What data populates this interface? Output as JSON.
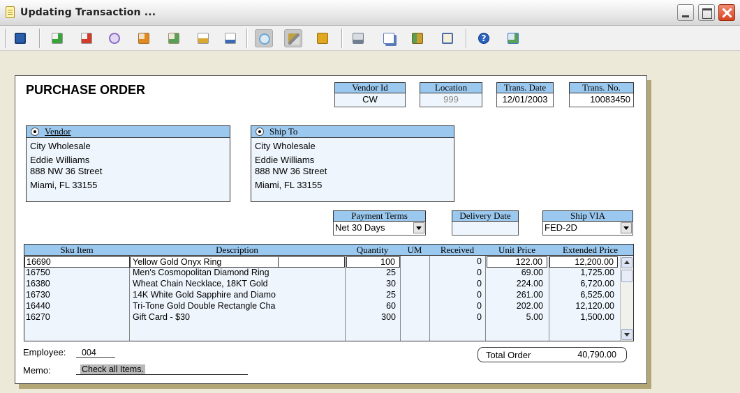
{
  "window": {
    "title": "Updating Transaction ..."
  },
  "toolbar": {
    "buttons": [
      {
        "name": "save-icon",
        "color": "#2a5ea8"
      },
      {
        "name": "add-new-icon",
        "color": "#3aa33a"
      },
      {
        "name": "delete-icon",
        "color": "#d23a2a"
      },
      {
        "name": "find-icon",
        "color": "#8a6bc2"
      },
      {
        "name": "approve-icon",
        "color": "#e08a20"
      },
      {
        "name": "add-item-icon",
        "color": "#58a058"
      },
      {
        "name": "import-icon",
        "color": "#d8a830"
      },
      {
        "name": "report-icon",
        "color": "#3a6ab8"
      },
      {
        "name": "refresh-icon",
        "color": "#6aa8d8"
      },
      {
        "name": "wand-icon",
        "color": "#c0a040"
      },
      {
        "name": "package-icon",
        "color": "#e0a820"
      },
      {
        "name": "print-icon",
        "color": "#708090"
      },
      {
        "name": "copy-icon",
        "color": "#5a7ab8"
      },
      {
        "name": "gift-icon",
        "color": "#c8a030"
      },
      {
        "name": "clipboard-icon",
        "color": "#4a6aa8"
      },
      {
        "name": "help-icon",
        "color": "#2a62c0"
      },
      {
        "name": "exit-icon",
        "color": "#3a7ac0"
      }
    ]
  },
  "document": {
    "title": "PURCHASE ORDER",
    "vendor_id": {
      "label": "Vendor Id",
      "value": "CW"
    },
    "location": {
      "label": "Location",
      "value": "999"
    },
    "trans_date": {
      "label": "Trans. Date",
      "value": "12/01/2003"
    },
    "trans_no": {
      "label": "Trans. No.",
      "value": "10083450"
    },
    "vendor": {
      "label": "Vendor",
      "lines": [
        "City Wholesale",
        "Eddie Williams",
        "888 NW 36 Street",
        "Miami, FL 33155"
      ]
    },
    "ship_to": {
      "label": "Ship To",
      "lines": [
        "City Wholesale",
        "Eddie Williams",
        "888 NW 36 Street",
        "Miami, FL 33155"
      ]
    },
    "payment_terms": {
      "label": "Payment Terms",
      "value": "Net 30 Days"
    },
    "delivery_date": {
      "label": "Delivery Date",
      "value": ""
    },
    "ship_via": {
      "label": "Ship VIA",
      "value": "FED-2D"
    },
    "grid": {
      "columns": [
        "Sku Item",
        "Description",
        "Quantity",
        "UM",
        "Received",
        "Unit Price",
        "Extended Price"
      ],
      "rows": [
        {
          "sku": "16690",
          "desc": "Yellow Gold Onyx Ring",
          "qty": "100",
          "um": "",
          "received": "0",
          "unit": "122.00",
          "ext": "12,200.00"
        },
        {
          "sku": "16750",
          "desc": "Men's Cosmopolitan Diamond Ring",
          "qty": "25",
          "um": "",
          "received": "0",
          "unit": "69.00",
          "ext": "1,725.00"
        },
        {
          "sku": "16380",
          "desc": "Wheat Chain Necklace, 18KT Gold",
          "qty": "30",
          "um": "",
          "received": "0",
          "unit": "224.00",
          "ext": "6,720.00"
        },
        {
          "sku": "16730",
          "desc": "14K White Gold Sapphire and Diamo",
          "qty": "25",
          "um": "",
          "received": "0",
          "unit": "261.00",
          "ext": "6,525.00"
        },
        {
          "sku": "16440",
          "desc": "Tri-Tone Gold Double Rectangle Cha",
          "qty": "60",
          "um": "",
          "received": "0",
          "unit": "202.00",
          "ext": "12,120.00"
        },
        {
          "sku": "16270",
          "desc": "Gift Card - $30",
          "qty": "300",
          "um": "",
          "received": "0",
          "unit": "5.00",
          "ext": "1,500.00"
        }
      ]
    },
    "employee": {
      "label": "Employee:",
      "value": "004"
    },
    "memo": {
      "label": "Memo:",
      "value": "Check all Items."
    },
    "total": {
      "label": "Total Order",
      "value": "40,790.00"
    }
  }
}
